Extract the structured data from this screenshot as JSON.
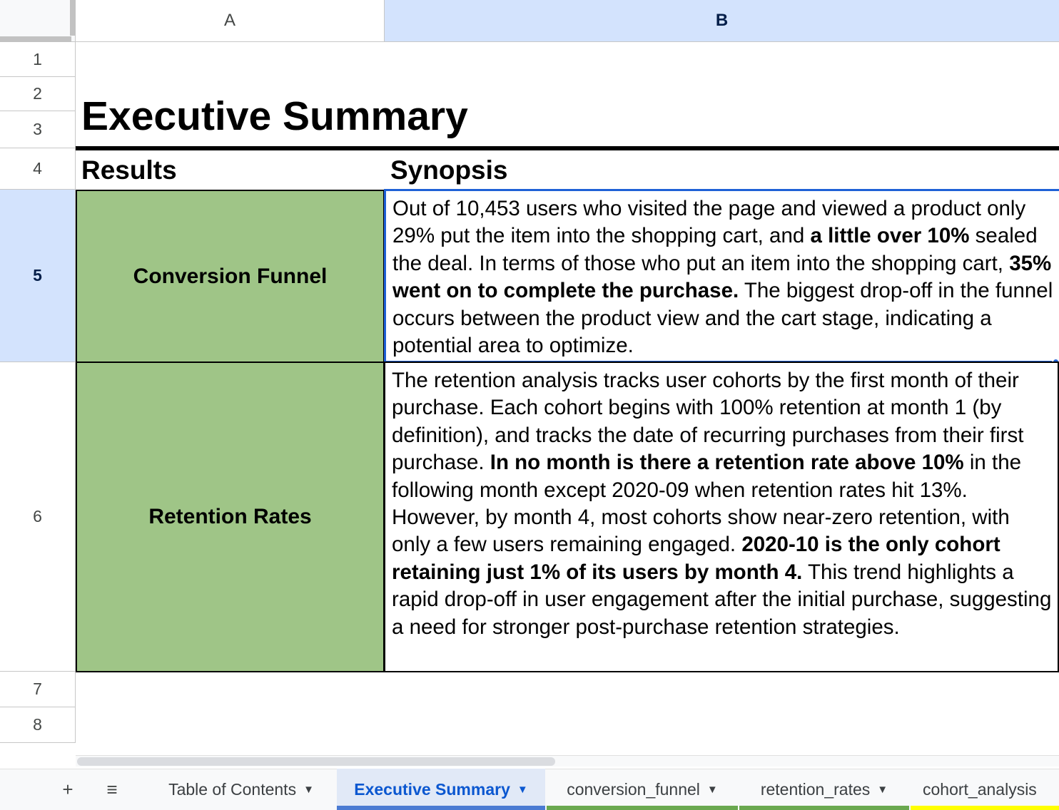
{
  "columns": [
    {
      "label": "A",
      "selected": false
    },
    {
      "label": "B",
      "selected": true
    }
  ],
  "rows": [
    "1",
    "2",
    "3",
    "4",
    "5",
    "6",
    "7",
    "8"
  ],
  "title": "Executive Summary",
  "headers": {
    "results": "Results",
    "synopsis": "Synopsis"
  },
  "entries": [
    {
      "result": "Conversion Funnel",
      "synopsis_parts": [
        {
          "text": "Out of 10,453 users who visited the page and viewed a product only 29% put the item into the shopping cart, and ",
          "bold": false
        },
        {
          "text": "a little over 10%",
          "bold": true
        },
        {
          "text": " sealed the deal. In terms of those who put an item into the shopping cart, ",
          "bold": false
        },
        {
          "text": "35% went on to complete the purchase.",
          "bold": true
        },
        {
          "text": " The biggest drop-off in the funnel occurs between the product view and the cart stage, indicating a potential area to optimize.",
          "bold": false
        }
      ]
    },
    {
      "result": "Retention Rates",
      "synopsis_parts": [
        {
          "text": "The retention analysis tracks user cohorts by the first month of their purchase. Each cohort begins with 100% retention at month 1 (by definition), and tracks the date of recurring purchases from their first purchase. ",
          "bold": false
        },
        {
          "text": "In no month is there a retention rate above 10%",
          "bold": true
        },
        {
          "text": " in the following month except 2020-09 when retention rates hit 13%.  However, by month 4, most cohorts show near-zero retention, with only a few users remaining engaged. ",
          "bold": false
        },
        {
          "text": "2020-10 is the only cohort retaining just 1% of its users by month 4.",
          "bold": true
        },
        {
          "text": " This trend highlights a rapid drop-off in user engagement after the initial purchase, suggesting a need for stronger post-purchase retention strategies.",
          "bold": false
        }
      ]
    }
  ],
  "colors": {
    "result_fill": "#9fc587",
    "selection": "#1f61d6",
    "header_selected": "#d3e3fd"
  },
  "sheet_bar": {
    "add_icon": "+",
    "list_icon": "≡",
    "tabs": [
      {
        "label": "Table of Contents",
        "active": false,
        "color": ""
      },
      {
        "label": "Executive Summary",
        "active": true,
        "color": "#4a7bd3"
      },
      {
        "label": "conversion_funnel",
        "active": false,
        "color": "#6aa84f"
      },
      {
        "label": "retention_rates",
        "active": false,
        "color": "#6aa84f"
      },
      {
        "label": "cohort_analysis",
        "active": false,
        "color": "#ffff00"
      }
    ]
  }
}
